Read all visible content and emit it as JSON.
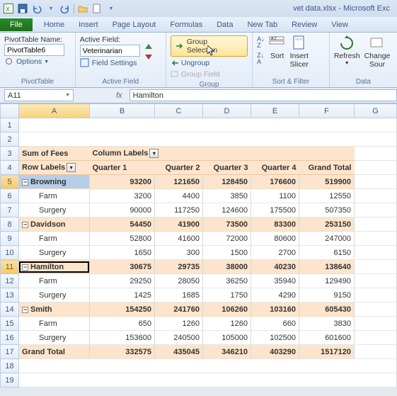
{
  "app": {
    "title": "vet data.xlsx - Microsoft Exc"
  },
  "qat": {
    "save": "save-icon",
    "undo": "undo-icon",
    "redo": "redo-icon",
    "open": "open-icon",
    "new": "new-icon"
  },
  "menu": {
    "file": "File",
    "home": "Home",
    "insert": "Insert",
    "pagelayout": "Page Layout",
    "formulas": "Formulas",
    "data": "Data",
    "newtab": "New Tab",
    "review": "Review",
    "view": "View"
  },
  "ribbon": {
    "pivotname_label": "PivotTable Name:",
    "pivotname_value": "PivotTable6",
    "options": "Options",
    "pivottable_group": "PivotTable",
    "activefield_label": "Active Field:",
    "activefield_value": "Veterinarian",
    "fieldsettings": "Field Settings",
    "activefield_group": "Active Field",
    "group_selection": "Group Selection",
    "ungroup": "Ungroup",
    "group_field": "Group Field",
    "group_group": "Group",
    "sort": "Sort",
    "sortfilter_group": "Sort & Filter",
    "insert_slicer": "Insert\nSlicer",
    "refresh": "Refresh",
    "changesource": "Change\nSour",
    "data_group": "Data"
  },
  "namebox": "A11",
  "fx": "Hamilton",
  "cols": [
    "A",
    "B",
    "C",
    "D",
    "E",
    "F",
    "G"
  ],
  "rows": [
    "1",
    "2",
    "3",
    "4",
    "5",
    "6",
    "7",
    "8",
    "9",
    "10",
    "11",
    "12",
    "13",
    "14",
    "15",
    "16",
    "17",
    "18",
    "19"
  ],
  "pivot": {
    "sum_of_fees": "Sum of Fees",
    "column_labels": "Column Labels",
    "row_labels": "Row Labels",
    "quarters": [
      "Quarter 1",
      "Quarter 2",
      "Quarter 3",
      "Quarter 4"
    ],
    "grand_total_h": "Grand Total",
    "groups": [
      {
        "name": "Browning",
        "vals": [
          93200,
          121650,
          128450,
          176600,
          519900
        ],
        "sub": [
          {
            "name": "Farm",
            "vals": [
              3200,
              4400,
              3850,
              1100,
              12550
            ]
          },
          {
            "name": "Surgery",
            "vals": [
              90000,
              117250,
              124600,
              175500,
              507350
            ]
          }
        ]
      },
      {
        "name": "Davidson",
        "vals": [
          54450,
          41900,
          73500,
          83300,
          253150
        ],
        "sub": [
          {
            "name": "Farm",
            "vals": [
              52800,
              41600,
              72000,
              80600,
              247000
            ]
          },
          {
            "name": "Surgery",
            "vals": [
              1650,
              300,
              1500,
              2700,
              6150
            ]
          }
        ]
      },
      {
        "name": "Hamilton",
        "vals": [
          30675,
          29735,
          38000,
          40230,
          138640
        ],
        "sub": [
          {
            "name": "Farm",
            "vals": [
              29250,
              28050,
              36250,
              35940,
              129490
            ]
          },
          {
            "name": "Surgery",
            "vals": [
              1425,
              1685,
              1750,
              4290,
              9150
            ]
          }
        ]
      },
      {
        "name": "Smith",
        "vals": [
          154250,
          241760,
          106260,
          103160,
          605430
        ],
        "sub": [
          {
            "name": "Farm",
            "vals": [
              650,
              1260,
              1260,
              660,
              3830
            ]
          },
          {
            "name": "Surgery",
            "vals": [
              153600,
              240500,
              105000,
              102500,
              601600
            ]
          }
        ]
      }
    ],
    "grand_total_label": "Grand Total",
    "grand_total": [
      332575,
      435045,
      346210,
      403290,
      1517120
    ]
  }
}
